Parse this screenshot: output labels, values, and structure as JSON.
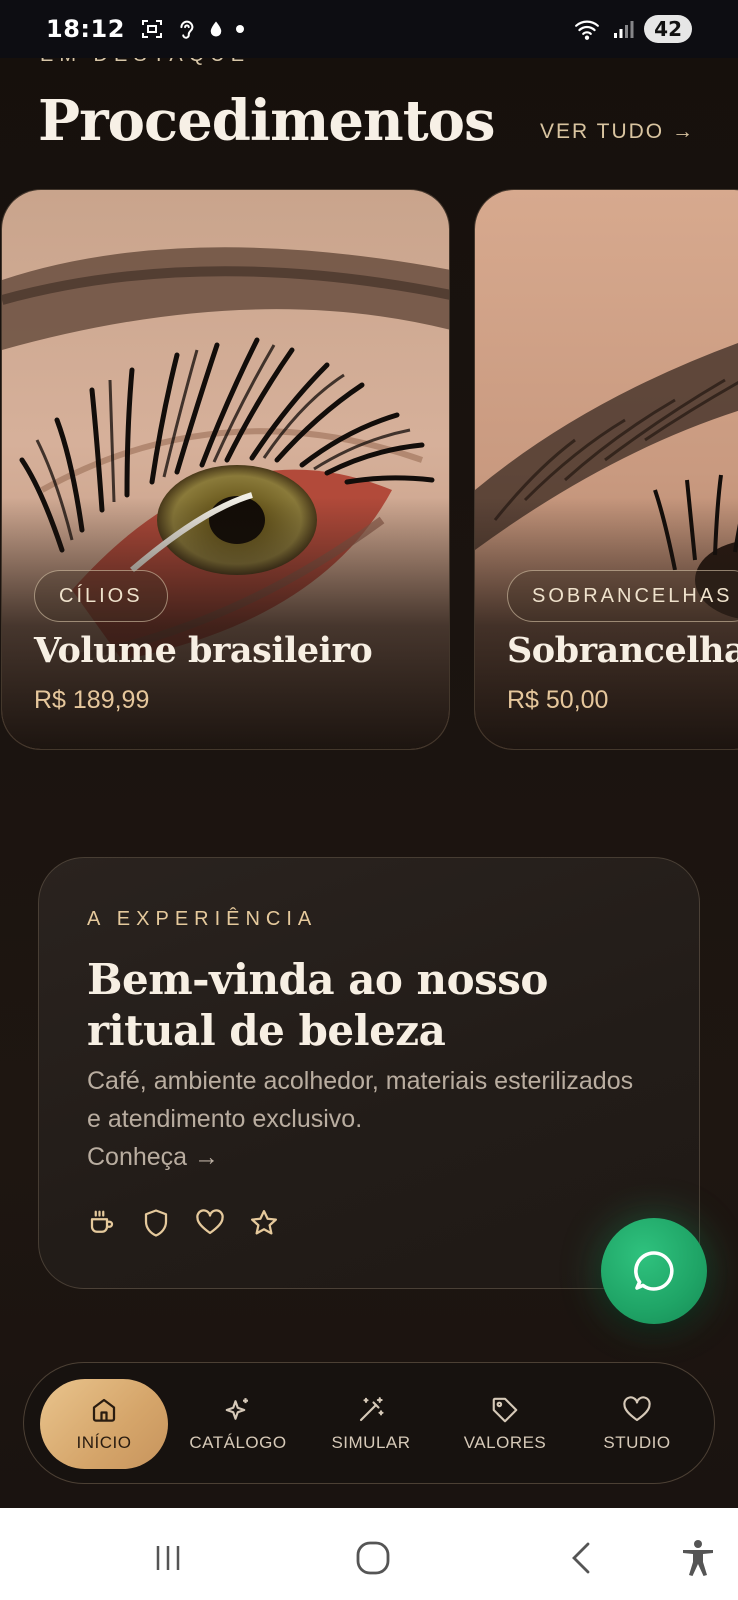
{
  "status_bar": {
    "time": "18:12",
    "battery": "42",
    "icons_left": [
      "screenshot-icon",
      "hearing-icon",
      "drop-icon",
      "dot-icon"
    ],
    "icons_right": [
      "wifi-icon",
      "signal-icon"
    ]
  },
  "header": {
    "eyebrow": "EM DESTAQUE",
    "title": "Procedimentos",
    "see_all": "VER TUDO →"
  },
  "cards": [
    {
      "tag": "CÍLIOS",
      "name": "Volume brasileiro",
      "price": "R$ 189,99"
    },
    {
      "tag": "SOBRANCELHAS",
      "name": "Sobrancelha g",
      "price": "R$ 50,00"
    }
  ],
  "experience": {
    "eyebrow": "A EXPERIÊNCIA",
    "title": "Bem-vinda ao nosso ritual de beleza",
    "text": "Café, ambiente acolhedor, materiais esterilizados e atendimento exclusivo.",
    "link": "Conheça →",
    "icons": [
      "coffee-icon",
      "shield-icon",
      "heart-icon",
      "star-icon"
    ]
  },
  "fab": {
    "icon": "whatsapp-icon"
  },
  "nav": {
    "items": [
      {
        "label": "INÍCIO",
        "icon": "home-icon",
        "active": true
      },
      {
        "label": "CATÁLOGO",
        "icon": "sparkles-icon",
        "active": false
      },
      {
        "label": "SIMULAR",
        "icon": "magic-wand-icon",
        "active": false
      },
      {
        "label": "VALORES",
        "icon": "tag-icon",
        "active": false
      },
      {
        "label": "STUDIO",
        "icon": "heart-icon",
        "active": false
      }
    ]
  },
  "system_nav": [
    "recents-button",
    "home-button",
    "back-button",
    "accessibility-button"
  ],
  "colors": {
    "background": "#1a130f",
    "accent_gold": "#e6c79c",
    "active_nav": "#d5a56a",
    "whatsapp": "#1fa466"
  }
}
